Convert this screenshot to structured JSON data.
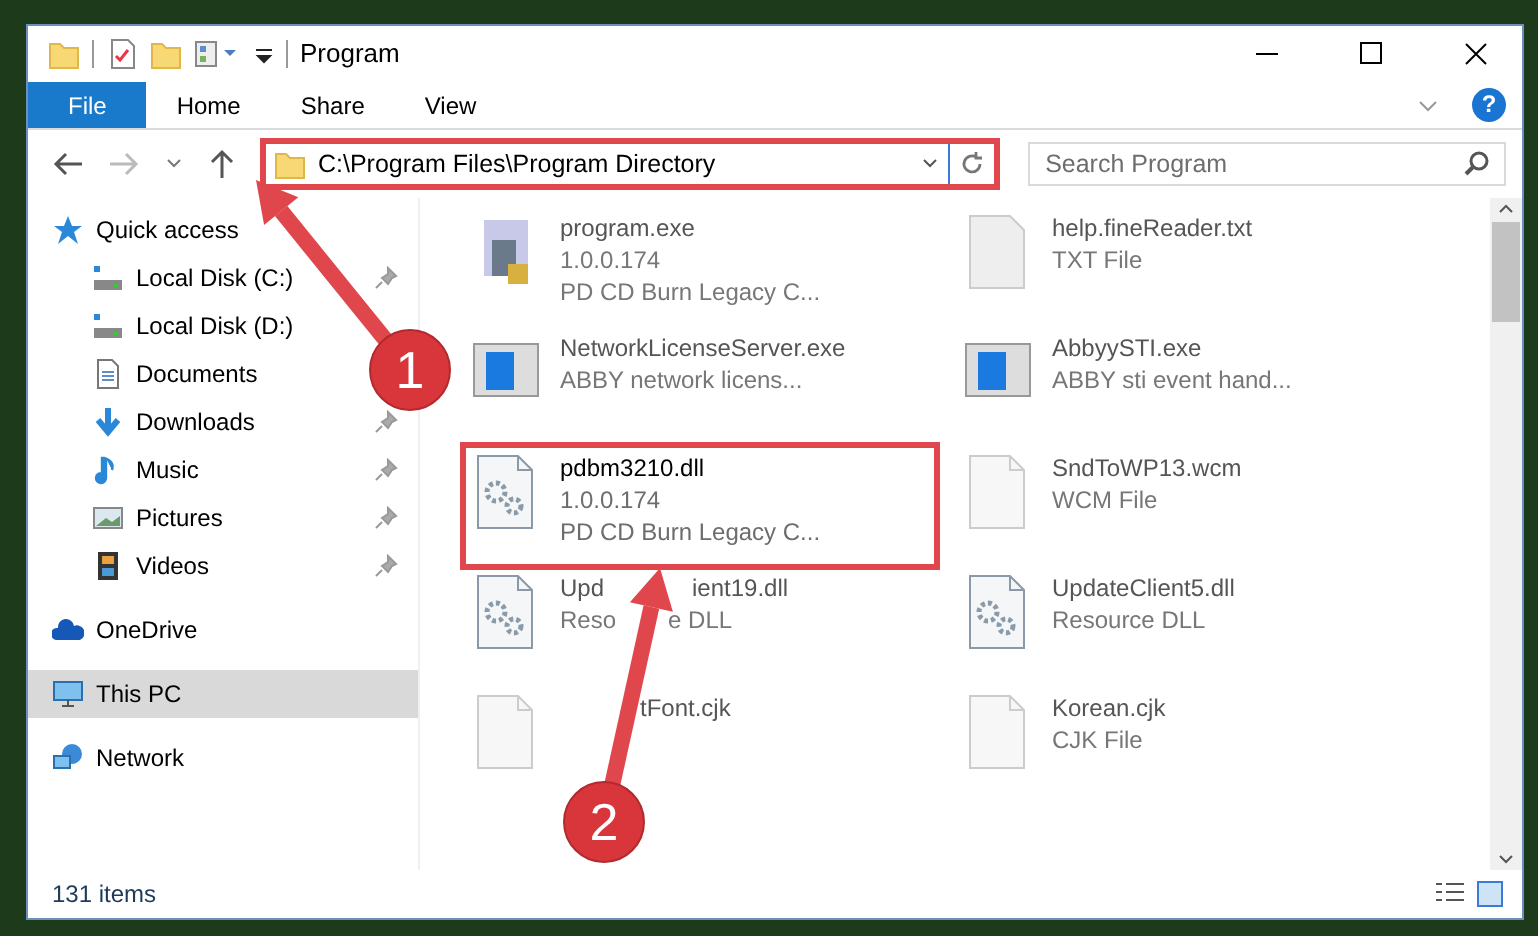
{
  "window": {
    "title": "Program"
  },
  "ribbon_tabs": [
    {
      "label": "File",
      "kind": "file",
      "selected": false
    },
    {
      "label": "Home",
      "kind": "tab",
      "selected": false
    },
    {
      "label": "Share",
      "kind": "tab",
      "selected": false
    },
    {
      "label": "View",
      "kind": "tab",
      "selected": false
    }
  ],
  "help_label": "?",
  "address_bar": {
    "path": "C:\\Program Files\\Program Directory",
    "highlighted": true
  },
  "search": {
    "placeholder": "Search Program"
  },
  "sidebar": {
    "items": [
      {
        "label": "Quick access",
        "kind": "star",
        "pinned": false,
        "selected": false,
        "children": [
          {
            "label": "Local Disk (C:)",
            "kind": "drive",
            "pinned": true,
            "selected": false
          },
          {
            "label": "Local Disk (D:)",
            "kind": "drive",
            "pinned": false,
            "selected": false
          },
          {
            "label": "Documents",
            "kind": "doc",
            "pinned": false,
            "selected": false
          },
          {
            "label": "Downloads",
            "kind": "download",
            "pinned": true,
            "selected": false
          },
          {
            "label": "Music",
            "kind": "music",
            "pinned": true,
            "selected": false
          },
          {
            "label": "Pictures",
            "kind": "picture",
            "pinned": true,
            "selected": false
          },
          {
            "label": "Videos",
            "kind": "video",
            "pinned": true,
            "selected": false
          }
        ]
      },
      {
        "label": "OneDrive",
        "kind": "cloud",
        "pinned": false,
        "selected": false
      },
      {
        "label": "This PC",
        "kind": "pc",
        "pinned": false,
        "selected": true
      },
      {
        "label": "Network",
        "kind": "network",
        "pinned": false,
        "selected": false
      }
    ]
  },
  "files": [
    {
      "name_parts": [
        "program.exe"
      ],
      "lines": [
        [
          "1.0.0.174"
        ],
        [
          "PD CD Burn Legacy C..."
        ]
      ],
      "kind": "exe",
      "highlighted": false
    },
    {
      "name_parts": [
        "help.fineReader.txt"
      ],
      "lines": [
        [
          "TXT File"
        ]
      ],
      "kind": "blank",
      "highlighted": false
    },
    {
      "name_parts": [
        "NetworkLicenseServer.exe"
      ],
      "lines": [
        [
          "ABBY network licens..."
        ]
      ],
      "kind": "app",
      "highlighted": false
    },
    {
      "name_parts": [
        "AbbyySTI.exe"
      ],
      "lines": [
        [
          "ABBY sti event hand..."
        ]
      ],
      "kind": "app",
      "highlighted": false
    },
    {
      "name_parts": [
        "pdbm3210.dll"
      ],
      "lines": [
        [
          "1.0.0.174"
        ],
        [
          "PD CD Burn Legacy C..."
        ]
      ],
      "kind": "dll",
      "highlighted": true
    },
    {
      "name_parts": [
        "SndToWP13.wcm"
      ],
      "lines": [
        [
          "WCM File"
        ]
      ],
      "kind": "page",
      "highlighted": false
    },
    {
      "name_parts": [
        "Upd",
        "ient19.dll"
      ],
      "lines": [
        [
          "Reso",
          "e DLL"
        ]
      ],
      "kind": "dll",
      "highlighted": false
    },
    {
      "name_parts": [
        "UpdateClient5.dll"
      ],
      "lines": [
        [
          "Resource DLL"
        ]
      ],
      "kind": "dll",
      "highlighted": false
    },
    {
      "name_parts": [
        "tFont.cjk"
      ],
      "kind": "page",
      "highlighted": false,
      "covered_start": true
    },
    {
      "name_parts": [
        "Korean.cjk"
      ],
      "lines": [
        [
          "CJK File"
        ]
      ],
      "kind": "page",
      "highlighted": false
    }
  ],
  "status_bar": {
    "count": "131 items"
  },
  "annotations": [
    {
      "number": "1"
    },
    {
      "number": "2"
    }
  ]
}
